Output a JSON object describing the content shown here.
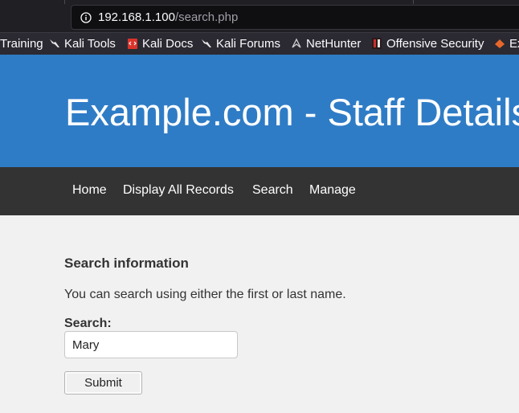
{
  "browser": {
    "url_host": "192.168.1.100",
    "url_path": "/search.php",
    "bookmarks": [
      {
        "label": "Training",
        "icon": "none"
      },
      {
        "label": "Kali Tools",
        "icon": "kali-dragon-icon"
      },
      {
        "label": "Kali Docs",
        "icon": "kali-docs-icon"
      },
      {
        "label": "Kali Forums",
        "icon": "kali-dragon-icon"
      },
      {
        "label": "NetHunter",
        "icon": "nethunter-icon"
      },
      {
        "label": "Offensive Security",
        "icon": "offsec-icon"
      },
      {
        "label": "Ex",
        "icon": "exploit-db-icon"
      }
    ]
  },
  "header": {
    "title": "Example.com - Staff Details"
  },
  "nav": {
    "items": [
      "Home",
      "Display All Records",
      "Search",
      "Manage"
    ]
  },
  "main": {
    "heading": "Search information",
    "description": "You can search using either the first or last name.",
    "search_label": "Search:",
    "search_value": "Mary",
    "submit_label": "Submit"
  },
  "colors": {
    "header_bg": "#2f7cc6",
    "nav_bg": "#333333",
    "page_bg": "#f1f1f1"
  }
}
